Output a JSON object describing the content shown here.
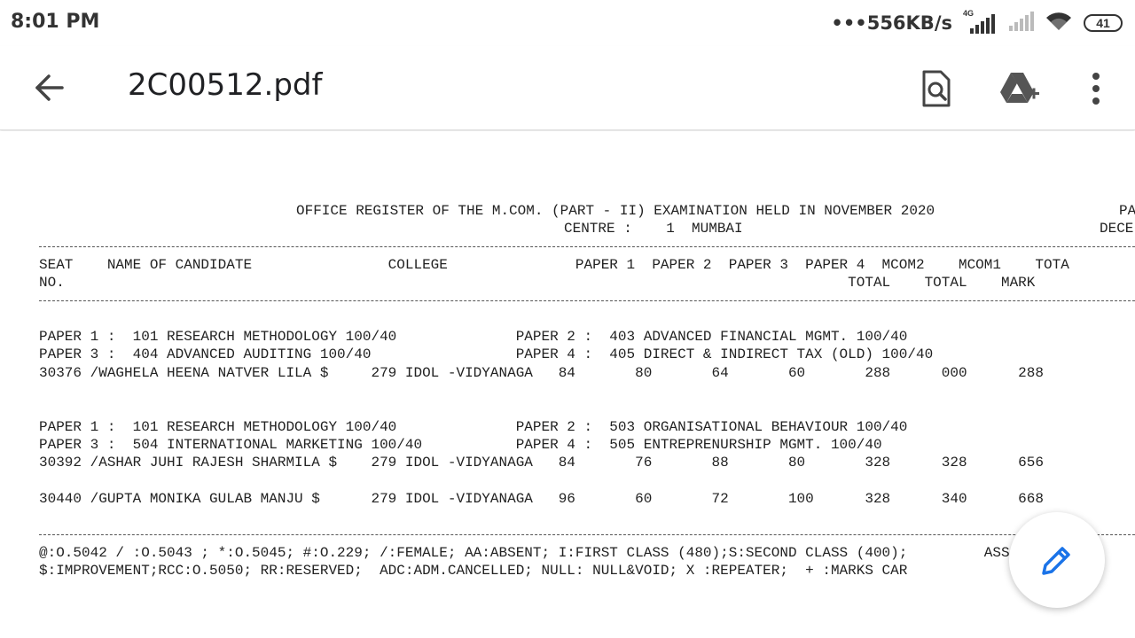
{
  "status_bar": {
    "time": "8:01 PM",
    "dots": "•••",
    "net_speed": "556KB/s",
    "network_type": "4G",
    "battery": "41"
  },
  "app_bar": {
    "title": "2C00512.pdf",
    "back_icon": "arrow-back-icon",
    "search_icon": "find-in-page-icon",
    "drive_icon": "add-to-drive-icon",
    "menu_icon": "more-vert-icon"
  },
  "document": {
    "title_line": "OFFICE REGISTER OF THE M.COM. (PART - II) EXAMINATION HELD IN NOVEMBER 2020",
    "title_right": "PA",
    "centre_line": "CENTRE :    1  MUMBAI",
    "centre_right": "DECE",
    "header_line1": "SEAT    NAME OF CANDIDATE                COLLEGE               PAPER 1  PAPER 2  PAPER 3  PAPER 4  MCOM2    MCOM1    TOTA",
    "header_line2": "NO.                                                                                            TOTAL    TOTAL    MARK",
    "block1": [
      "PAPER 1 :  101 RESEARCH METHODOLOGY 100/40              PAPER 2 :  403 ADVANCED FINANCIAL MGMT. 100/40",
      "PAPER 3 :  404 ADVANCED AUDITING 100/40                 PAPER 4 :  405 DIRECT & INDIRECT TAX (OLD) 100/40",
      "30376 /WAGHELA HEENA NATVER LILA $     279 IDOL -VIDYANAGA   84       80       64       60       288      000      288"
    ],
    "block2": [
      "PAPER 1 :  101 RESEARCH METHODOLOGY 100/40              PAPER 2 :  503 ORGANISATIONAL BEHAVIOUR 100/40",
      "PAPER 3 :  504 INTERNATIONAL MARKETING 100/40           PAPER 4 :  505 ENTREPRENURSHIP MGMT. 100/40",
      "30392 /ASHAR JUHI RAJESH SHARMILA $    279 IDOL -VIDYANAGA   84       76       88       80       328      328      656",
      "",
      "30440 /GUPTA MONIKA GULAB MANJU $      279 IDOL -VIDYANAGA   96       60       72       100      328      340      668"
    ],
    "legend": [
      "@:O.5042 / :O.5043 ; *:O.5045; #:O.229; /:FEMALE; AA:ABSENT; I:FIRST CLASS (480);S:SECOND CLASS (400);         ASS",
      "$:IMPROVEMENT;RCC:O.5050; RR:RESERVED;  ADC:ADM.CANCELLED; NULL: NULL&VOID; X :REPEATER;  + :MARKS CAR"
    ]
  },
  "fab": {
    "icon": "edit-pencil-icon"
  },
  "colors": {
    "accent": "#1a73e8",
    "text": "#222222"
  }
}
